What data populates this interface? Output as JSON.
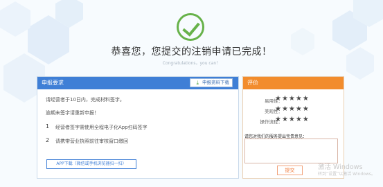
{
  "header": {
    "title": "恭喜您，您提交的注销申请已完成！",
    "subtitle": "Congratulations，you can！"
  },
  "left_panel": {
    "title": "申报要求",
    "download_label": "申报资料下载",
    "lines": [
      "请经营者于10日内，完成材料签字。",
      "逾期未签字请重新申报！"
    ],
    "steps": [
      {
        "num": "1",
        "text": "经营者签字需使用全程电子化App扫码签字"
      },
      {
        "num": "2",
        "text": "请携带营业执照前往审核窗口缴回"
      }
    ],
    "app_button": "APP下载（微信或手机浏览器扫一扫）"
  },
  "right_panel": {
    "title": "评价",
    "ratings": [
      {
        "label": "易用性：",
        "stars": 5
      },
      {
        "label": "美观性：",
        "stars": 5
      },
      {
        "label": "操作流程：",
        "stars": 5
      }
    ],
    "opinion_label": "请您对我们的服务提出宝贵意见：",
    "submit_label": "提交"
  },
  "watermark": {
    "line1": "激活 Windows",
    "line2": "转到“设置”以激活 Windows。"
  },
  "colors": {
    "accent_blue": "#3f7fd6",
    "accent_orange": "#f28c2d",
    "success_green": "#67b24a"
  }
}
